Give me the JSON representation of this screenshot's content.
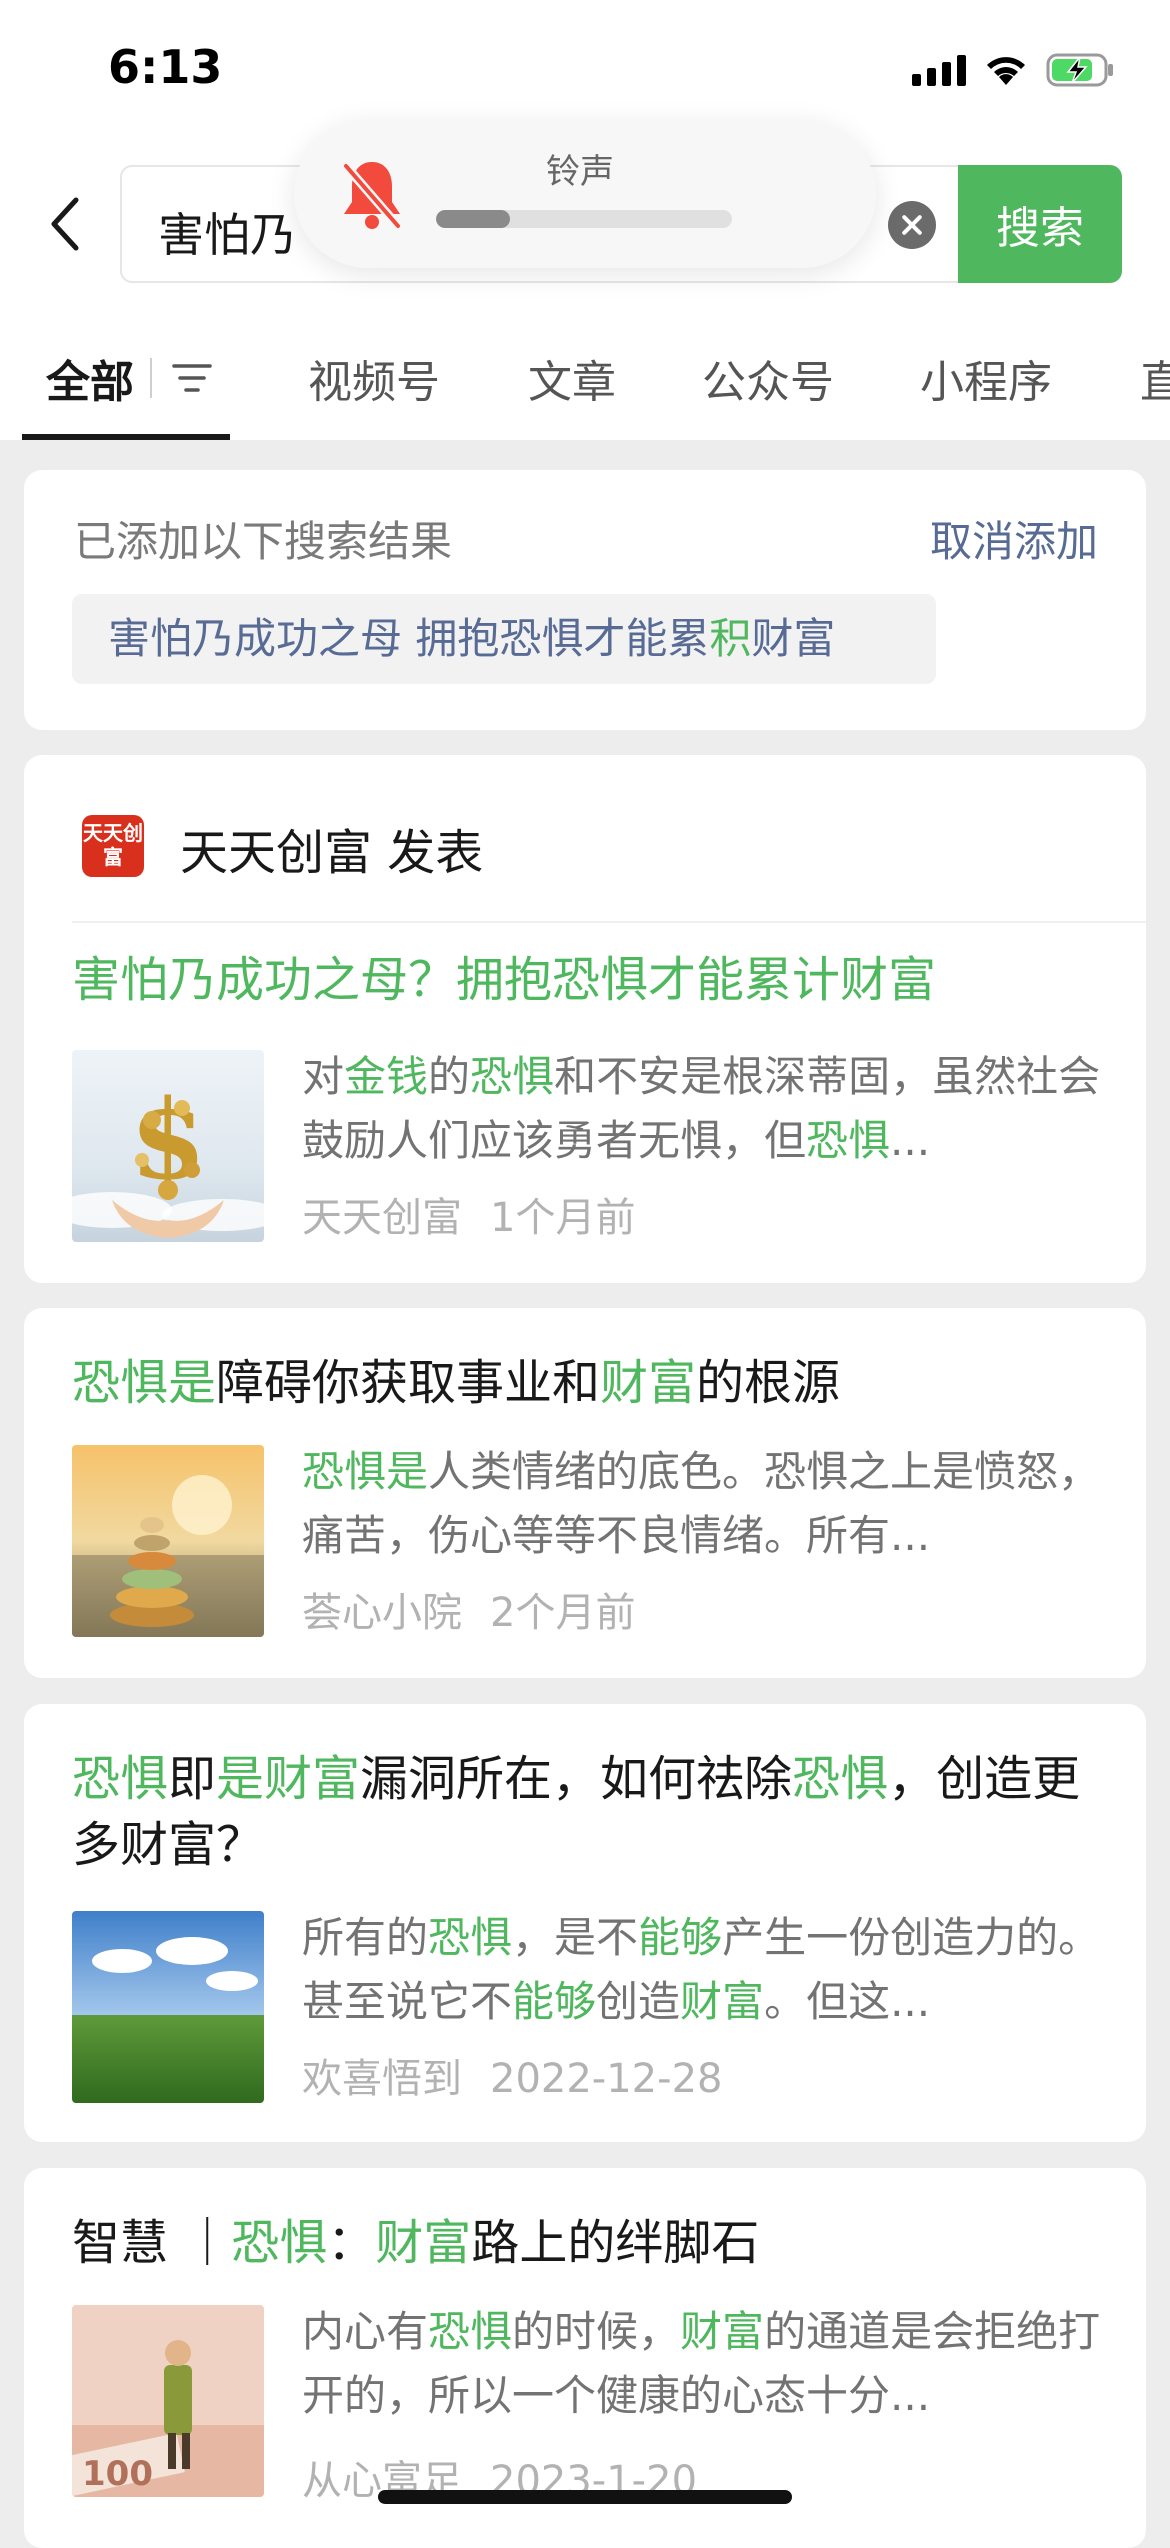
{
  "status_bar": {
    "time": "6:13"
  },
  "search": {
    "query": "害怕乃",
    "button_label": "搜索"
  },
  "ringtone": {
    "label": "铃声",
    "volume_level_percent": 25
  },
  "tabs": [
    {
      "label": "全部",
      "active": true
    },
    {
      "label": "视频号",
      "active": false
    },
    {
      "label": "文章",
      "active": false
    },
    {
      "label": "公众号",
      "active": false
    },
    {
      "label": "小程序",
      "active": false
    },
    {
      "label": "直",
      "active": false
    }
  ],
  "added_results": {
    "title": "已添加以下搜索结果",
    "cancel_label": "取消添加",
    "chip_segments": [
      "害怕乃成功之母 拥抱恐惧才能累",
      "积",
      "财富"
    ]
  },
  "results": [
    {
      "publisher_logo_text": "天天创富",
      "publisher_line": "天天创富 发表",
      "title_segments": [
        {
          "text": "害怕乃成功之母？拥抱恐惧才能累计财富",
          "hl": true
        }
      ],
      "desc_segments": [
        {
          "text": "对",
          "hl": false
        },
        {
          "text": "金钱",
          "hl": true
        },
        {
          "text": "的",
          "hl": false
        },
        {
          "text": "恐惧",
          "hl": true
        },
        {
          "text": "和不安是根深蒂固，虽然社会鼓励人们应该勇者无惧，但",
          "hl": false
        },
        {
          "text": "恐惧",
          "hl": true
        },
        {
          "text": "...",
          "hl": false
        }
      ],
      "source": "天天创富",
      "date": "1个月前"
    },
    {
      "title_segments": [
        {
          "text": "恐惧是",
          "hl": true
        },
        {
          "text": "障碍你获取事业和",
          "hl": false
        },
        {
          "text": "财富",
          "hl": true
        },
        {
          "text": "的根源",
          "hl": false
        }
      ],
      "desc_segments": [
        {
          "text": "恐惧是",
          "hl": true
        },
        {
          "text": "人类情绪的底色。恐惧之上是愤怒，痛苦，伤心等等不良情绪。所有...",
          "hl": false
        }
      ],
      "source": "荟心小院",
      "date": "2个月前"
    },
    {
      "title_segments": [
        {
          "text": "恐惧",
          "hl": true
        },
        {
          "text": "即",
          "hl": false
        },
        {
          "text": "是财富",
          "hl": true
        },
        {
          "text": "漏洞所在，如何祛除",
          "hl": false
        },
        {
          "text": "恐惧",
          "hl": true
        },
        {
          "text": "，创造更多财富？",
          "hl": false
        }
      ],
      "desc_segments": [
        {
          "text": "所有的",
          "hl": false
        },
        {
          "text": "恐惧",
          "hl": true
        },
        {
          "text": "，是不",
          "hl": false
        },
        {
          "text": "能够",
          "hl": true
        },
        {
          "text": "产生一份创造力的。甚至说它不",
          "hl": false
        },
        {
          "text": "能够",
          "hl": true
        },
        {
          "text": "创造",
          "hl": false
        },
        {
          "text": "财富",
          "hl": true
        },
        {
          "text": "。但这...",
          "hl": false
        }
      ],
      "source": "欢喜悟到",
      "date": "2022-12-28"
    },
    {
      "title_segments": [
        {
          "text": "智慧 ｜",
          "hl": false
        },
        {
          "text": "恐惧",
          "hl": true
        },
        {
          "text": "：",
          "hl": false
        },
        {
          "text": "财富",
          "hl": true
        },
        {
          "text": "路上的绊脚石",
          "hl": false
        }
      ],
      "desc_segments": [
        {
          "text": "内心有",
          "hl": false
        },
        {
          "text": "恐惧",
          "hl": true
        },
        {
          "text": "的时候，",
          "hl": false
        },
        {
          "text": "财富",
          "hl": true
        },
        {
          "text": "的通道是会拒绝打开的，所以一个健康的心态十分...",
          "hl": false
        }
      ],
      "source": "从心富足",
      "date": "2023-1-20"
    }
  ],
  "colors": {
    "accent_green": "#4fb75e",
    "link_blue": "#576b95",
    "background": "#ededed"
  }
}
